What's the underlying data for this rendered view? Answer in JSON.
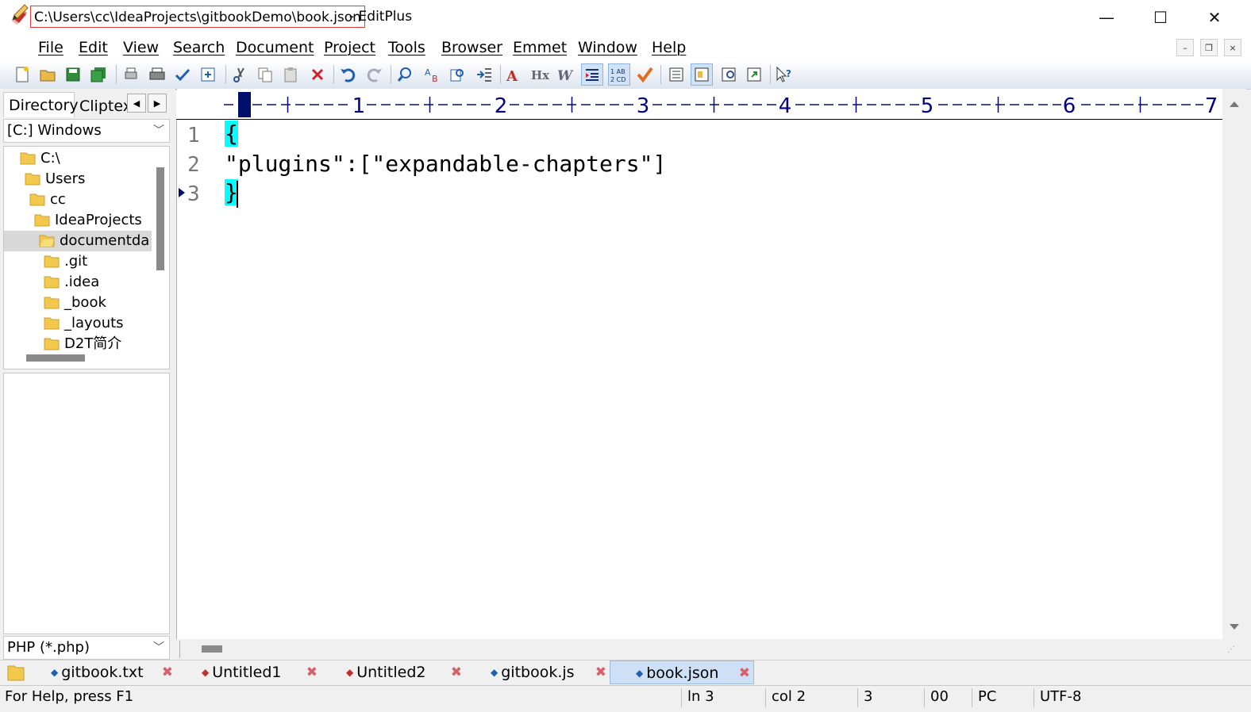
{
  "window": {
    "title_path": "C:\\Users\\cc\\IdeaProjects\\gitbookDemo\\book.json",
    "title_suffix": "- EditPlus",
    "minimize": "—",
    "maximize": "☐",
    "close": "✕"
  },
  "menu": {
    "items": [
      "File",
      "Edit",
      "View",
      "Search",
      "Document",
      "Project",
      "Tools",
      "Browser",
      "Emmet",
      "Window",
      "Help"
    ],
    "mdi": [
      "–",
      "❐",
      "×"
    ]
  },
  "sidebar": {
    "tabs": [
      "Directory",
      "Cliptext"
    ],
    "arrow_left": "◀",
    "arrow_right": "▶",
    "drive": "[C:] Windows",
    "tree": [
      "C:\\",
      "Users",
      "cc",
      "IdeaProjects",
      "documentda",
      ".git",
      ".idea",
      "_book",
      "_layouts",
      "D2T简介"
    ],
    "filetype": "PHP (*.php)"
  },
  "editor": {
    "ruler_numbers": [
      "1",
      "2",
      "3",
      "4",
      "5",
      "6",
      "7"
    ],
    "line_numbers": [
      "1",
      "2",
      "3"
    ],
    "lines": [
      "{",
      "\"plugins\":[\"expandable-chapters\"]",
      "}"
    ]
  },
  "doc_tabs": [
    "gitbook.txt",
    "Untitled1",
    "Untitled2",
    "gitbook.js",
    "book.json"
  ],
  "status": {
    "help": "For Help, press F1",
    "line": "ln 3",
    "col": "col 2",
    "lines_count": "3",
    "code": "00",
    "mode": "PC",
    "encoding": "UTF-8"
  },
  "colors": {
    "brace_highlight": "#00ffff",
    "ruler_text": "#000080",
    "active_tab": "#cde0f5"
  }
}
